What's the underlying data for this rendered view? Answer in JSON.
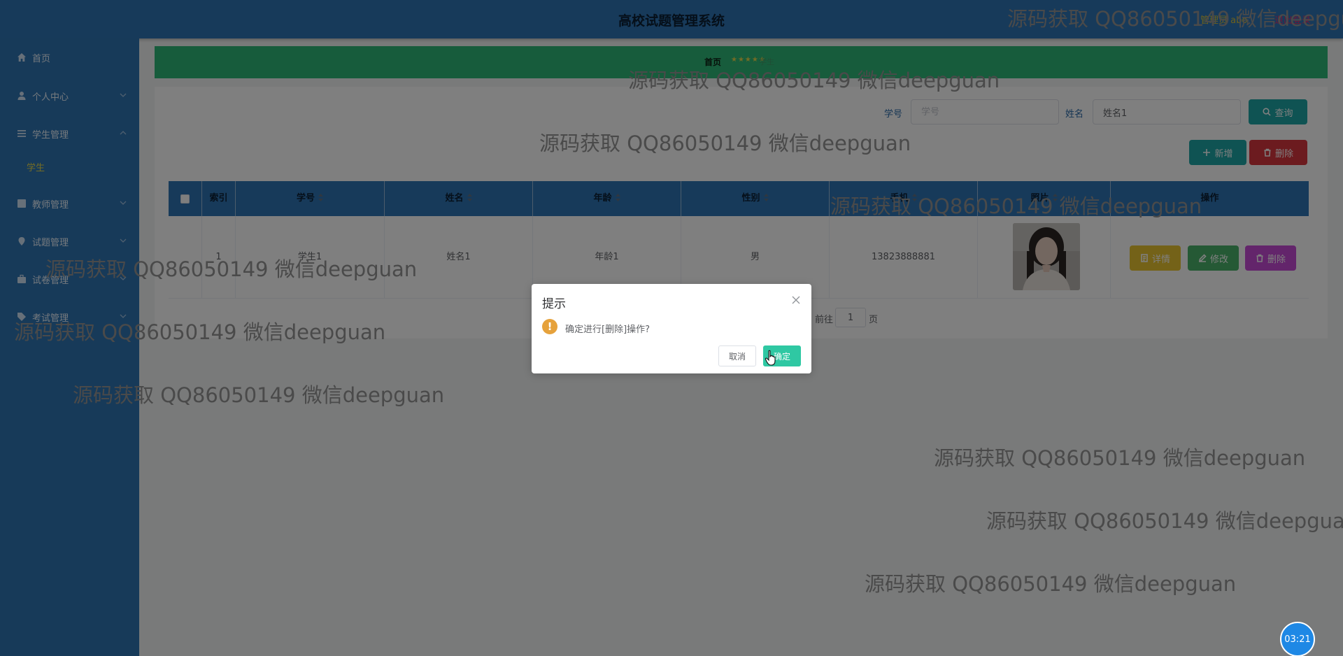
{
  "header": {
    "title": "高校试题管理系统",
    "user": "管理员 abo",
    "logout": "退出登录"
  },
  "sidebar": {
    "items": [
      {
        "label": "首页",
        "icon": "home-icon"
      },
      {
        "label": "个人中心",
        "icon": "user-icon"
      },
      {
        "label": "学生管理",
        "icon": "list-icon"
      },
      {
        "label": "教师管理",
        "icon": "grid-icon"
      },
      {
        "label": "试题管理",
        "icon": "pin-icon"
      },
      {
        "label": "试卷管理",
        "icon": "briefcase-icon"
      },
      {
        "label": "考试管理",
        "icon": "tag-icon"
      }
    ],
    "active_sub": "学生"
  },
  "breadcrumb": {
    "home": "首页",
    "stars": "★★★★★",
    "current": "学生"
  },
  "search": {
    "id_label": "学号",
    "id_placeholder": "学号",
    "id_value": "",
    "name_label": "姓名",
    "name_placeholder": "姓名",
    "name_value": "姓名1",
    "query_button": "查询"
  },
  "actions": {
    "add": "新增",
    "delete": "删除"
  },
  "table": {
    "columns": [
      "索引",
      "学号",
      "姓名",
      "年龄",
      "性别",
      "手机",
      "照片",
      "操作"
    ],
    "rows": [
      {
        "index": "1",
        "student_id": "学生1",
        "name": "姓名1",
        "age": "年龄1",
        "gender": "男",
        "phone": "13823888881"
      }
    ],
    "row_actions": {
      "detail": "详情",
      "edit": "修改",
      "delete": "删除"
    }
  },
  "pagination": {
    "goto_label": "前往",
    "page": "1",
    "page_suffix": "页"
  },
  "dialog": {
    "title": "提示",
    "message": "确定进行[删除]操作?",
    "cancel": "取消",
    "confirm": "确定"
  },
  "watermark": "源码获取 QQ86050149 微信deepguan",
  "timer": "03:21",
  "colors": {
    "header": "#2f75b5",
    "sidebar": "#2e74b3",
    "banner": "#2fb978",
    "confirm": "#2fc8a3",
    "warning": "#e6a23c"
  }
}
